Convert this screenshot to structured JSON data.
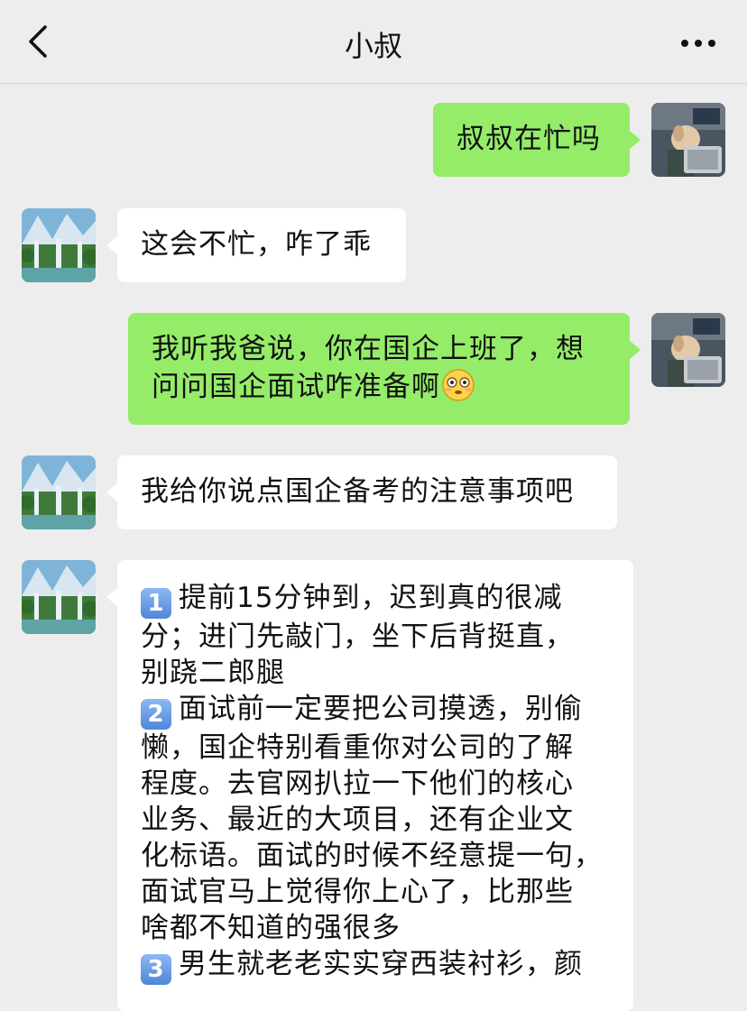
{
  "header": {
    "title": "小叔",
    "back_icon": "chevron-left-icon",
    "more_icon": "more-dots-icon"
  },
  "colors": {
    "background": "#ededed",
    "my_bubble": "#95ec69",
    "other_bubble": "#ffffff"
  },
  "messages": [
    {
      "sender": "me",
      "text": "叔叔在忙吗"
    },
    {
      "sender": "uncle",
      "text": "这会不忙，咋了乖"
    },
    {
      "sender": "me",
      "line1": "我听我爸说，你在国企上班了，想",
      "line2": "问问国企面试咋准备啊",
      "emoji": "flushed-face-emoji"
    },
    {
      "sender": "uncle",
      "text": "我给你说点国企备考的注意事项吧"
    },
    {
      "sender": "uncle",
      "items": [
        {
          "badge": "1",
          "lines": [
            "提前15分钟到，迟到真的很减",
            "分；进门先敲门，坐下后背挺直，",
            "别跷二郎腿"
          ]
        },
        {
          "badge": "2",
          "lines": [
            "面试前一定要把公司摸透，别偷",
            "懒，国企特别看重你对公司的了解",
            "程度。去官网扒拉一下他们的核心",
            "业务、最近的大项目，还有企业文",
            "化标语。面试的时候不经意提一句，",
            "面试官马上觉得你上心了，比那些",
            "啥都不知道的强很多"
          ]
        },
        {
          "badge": "3",
          "lines": [
            "男生就老老实实穿西装衬衫，颜"
          ]
        }
      ]
    }
  ]
}
